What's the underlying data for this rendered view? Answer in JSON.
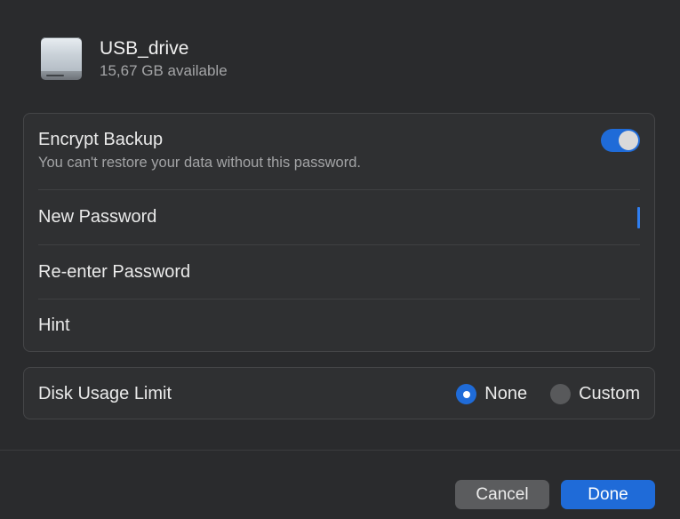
{
  "header": {
    "drive_name": "USB_drive",
    "available": "15,67 GB available",
    "icon": "external-drive-icon"
  },
  "encryption": {
    "label": "Encrypt Backup",
    "description": "You can't restore your data without this password.",
    "enabled": true
  },
  "fields": {
    "new_password_label": "New Password",
    "new_password_value": "",
    "reenter_password_label": "Re-enter Password",
    "reenter_password_value": "",
    "hint_label": "Hint",
    "hint_value": ""
  },
  "disk_usage": {
    "label": "Disk Usage Limit",
    "options": [
      "None",
      "Custom"
    ],
    "selected": "None"
  },
  "buttons": {
    "cancel": "Cancel",
    "done": "Done"
  },
  "colors": {
    "accent": "#1f6bd8",
    "background": "#2a2b2d",
    "card": "#2f3032"
  }
}
